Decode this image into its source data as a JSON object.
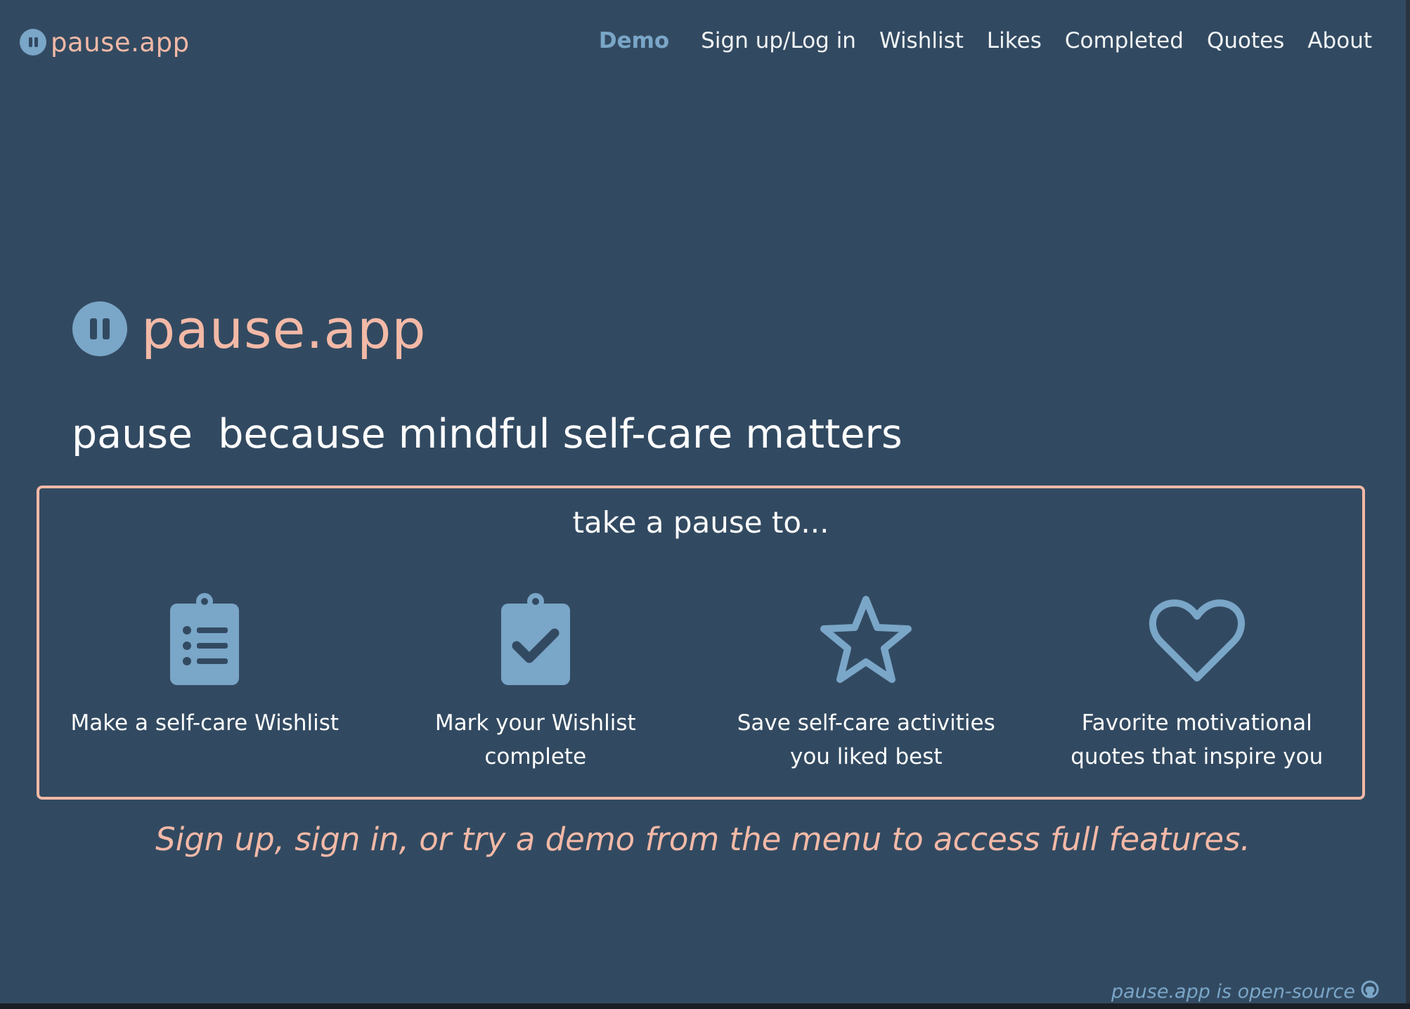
{
  "brand": {
    "name": "pause.app"
  },
  "nav": {
    "links": [
      "Demo",
      "Sign up/Log in",
      "Wishlist",
      "Likes",
      "Completed",
      "Quotes",
      "About"
    ]
  },
  "hero": {
    "title": "pause.app",
    "tagline": "pause  because mindful self-care matters"
  },
  "feature_box": {
    "heading": "take a pause to...",
    "features": [
      {
        "icon": "clipboard-list-icon",
        "text": "Make a self-care Wishlist"
      },
      {
        "icon": "clipboard-check-icon",
        "text": "Mark your Wishlist complete"
      },
      {
        "icon": "star-icon",
        "text": "Save self-care activities you liked best"
      },
      {
        "icon": "heart-icon",
        "text": "Favorite motivational quotes that inspire you"
      }
    ]
  },
  "cta": "Sign up, sign in, or try a demo from the menu to access full features.",
  "footer": {
    "text": "pause.app is open-source",
    "icon": "github-icon"
  },
  "colors": {
    "background": "#324a61",
    "accent_pink": "#f3b9a7",
    "accent_blue": "#7aa6c8",
    "text": "#ffffff"
  }
}
